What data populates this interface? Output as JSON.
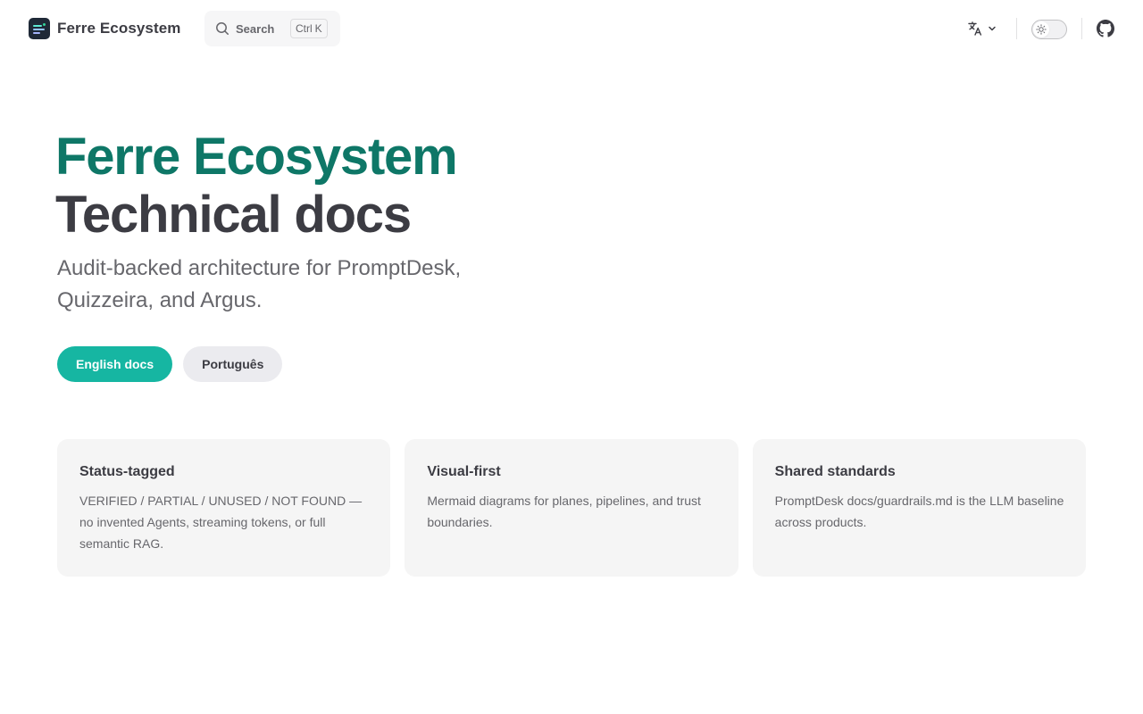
{
  "nav": {
    "brand": "Ferre Ecosystem",
    "search": {
      "label": "Search",
      "key_modifier": "Ctrl",
      "key": "K"
    },
    "icons": {
      "logo": "logo-icon",
      "search": "search-icon",
      "language": "translate-icon",
      "chevron": "chevron-down-icon",
      "theme": "sun-icon",
      "github": "github-icon"
    }
  },
  "hero": {
    "name": "Ferre Ecosystem",
    "text": "Technical docs",
    "tagline": "Audit-backed architecture for PromptDesk, Quizzeira, and Argus.",
    "actions": [
      {
        "label": "English docs",
        "theme": "brand"
      },
      {
        "label": "Português",
        "theme": "alt"
      }
    ]
  },
  "features": [
    {
      "title": "Status-tagged",
      "details": "VERIFIED / PARTIAL / UNUSED / NOT FOUND — no invented Agents, streaming tokens, or full semantic RAG."
    },
    {
      "title": "Visual-first",
      "details": "Mermaid diagrams for planes, pipelines, and trust boundaries."
    },
    {
      "title": "Shared standards",
      "details": "PromptDesk docs/guardrails.md is the LLM baseline across products."
    }
  ],
  "colors": {
    "brand": "#16b6a2",
    "brand_text": "#0e7767",
    "text": "#3c3c43",
    "muted": "#67676c",
    "card_bg": "#f5f5f5"
  }
}
